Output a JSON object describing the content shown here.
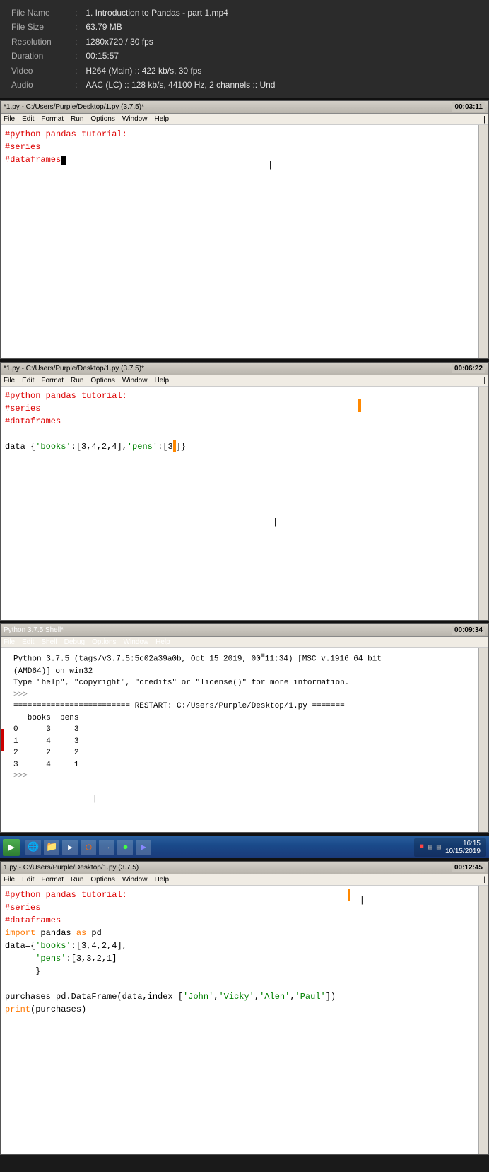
{
  "file_info": {
    "label_file_name": "File Name",
    "label_file_size": "File Size",
    "label_resolution": "Resolution",
    "label_duration": "Duration",
    "label_video": "Video",
    "label_audio": "Audio",
    "sep": ":",
    "file_name": "1. Introduction to Pandas - part 1.mp4",
    "file_size": "63.79 MB",
    "resolution": "1280x720 / 30 fps",
    "duration": "00:15:57",
    "video": "H264 (Main) :: 422 kb/s, 30 fps",
    "audio": "AAC (LC) :: 128 kb/s, 44100 Hz, 2 channels :: Und"
  },
  "panel1": {
    "title": "*1.py - C:/Users/Purple/Desktop/1.py (3.7.5)*",
    "timestamp": "00:03:11",
    "menu_items": [
      "File",
      "Edit",
      "Format",
      "Run",
      "Options",
      "Window",
      "Help"
    ],
    "code_lines": [
      "#python pandas tutorial:",
      "#series",
      "#dataframes"
    ]
  },
  "panel2": {
    "title": "*1.py - C:/Users/Purple/Desktop/1.py (3.7.5)*",
    "timestamp": "00:06:22",
    "menu_items": [
      "File",
      "Edit",
      "Format",
      "Run",
      "Options",
      "Window",
      "Help"
    ],
    "code_lines": [
      "#python pandas tutorial:",
      "#series",
      "#dataframes",
      "",
      "data={'books':[3,4,2,4],'pens':[3]}"
    ]
  },
  "panel3": {
    "title": "Python 3.7.5 Shell*",
    "timestamp": "00:09:34",
    "menu_items": [
      "File",
      "Edit",
      "Shell",
      "Debug",
      "Options",
      "Window",
      "Help"
    ],
    "shell_lines": [
      "Python 3.7.5 (tags/v3.7.5:5c02a39a0b, Oct 15 2019, 00:11:34) [MSC v.1916 64 bit",
      "(AMD64)] on win32",
      "Type \"help\", \"copyright\", \"credits\" or \"license()\" for more information.",
      ">>> ",
      "========================= RESTART: C:/Users/Purple/Desktop/1.py =======",
      "   books  pens",
      "0      3     3",
      "1      4     3",
      "2      2     2",
      "3      4     1",
      ">>> "
    ],
    "table": {
      "header": [
        "",
        "books",
        "pens"
      ],
      "rows": [
        [
          "0",
          "3",
          "3"
        ],
        [
          "1",
          "4",
          "3"
        ],
        [
          "2",
          "2",
          "2"
        ],
        [
          "3",
          "4",
          "1"
        ]
      ]
    }
  },
  "taskbar": {
    "time_line1": "16:15",
    "time_line2": "10/15/2019"
  },
  "panel4": {
    "title": "1.py - C:/Users/Purple/Desktop/1.py (3.7.5)",
    "timestamp": "00:12:45",
    "menu_items": [
      "File",
      "Edit",
      "Format",
      "Run",
      "Options",
      "Window",
      "Help"
    ],
    "code_lines": [
      "#python pandas tutorial:",
      "#series",
      "#dataframes",
      "import pandas as pd",
      "data={'books':[3,4,2,4],",
      "      'pens':[3,3,2,1]",
      "      }",
      "",
      "purchases=pd.DataFrame(data,index=['John','Vicky','Alen','Paul'])",
      "print(purchases)"
    ]
  }
}
